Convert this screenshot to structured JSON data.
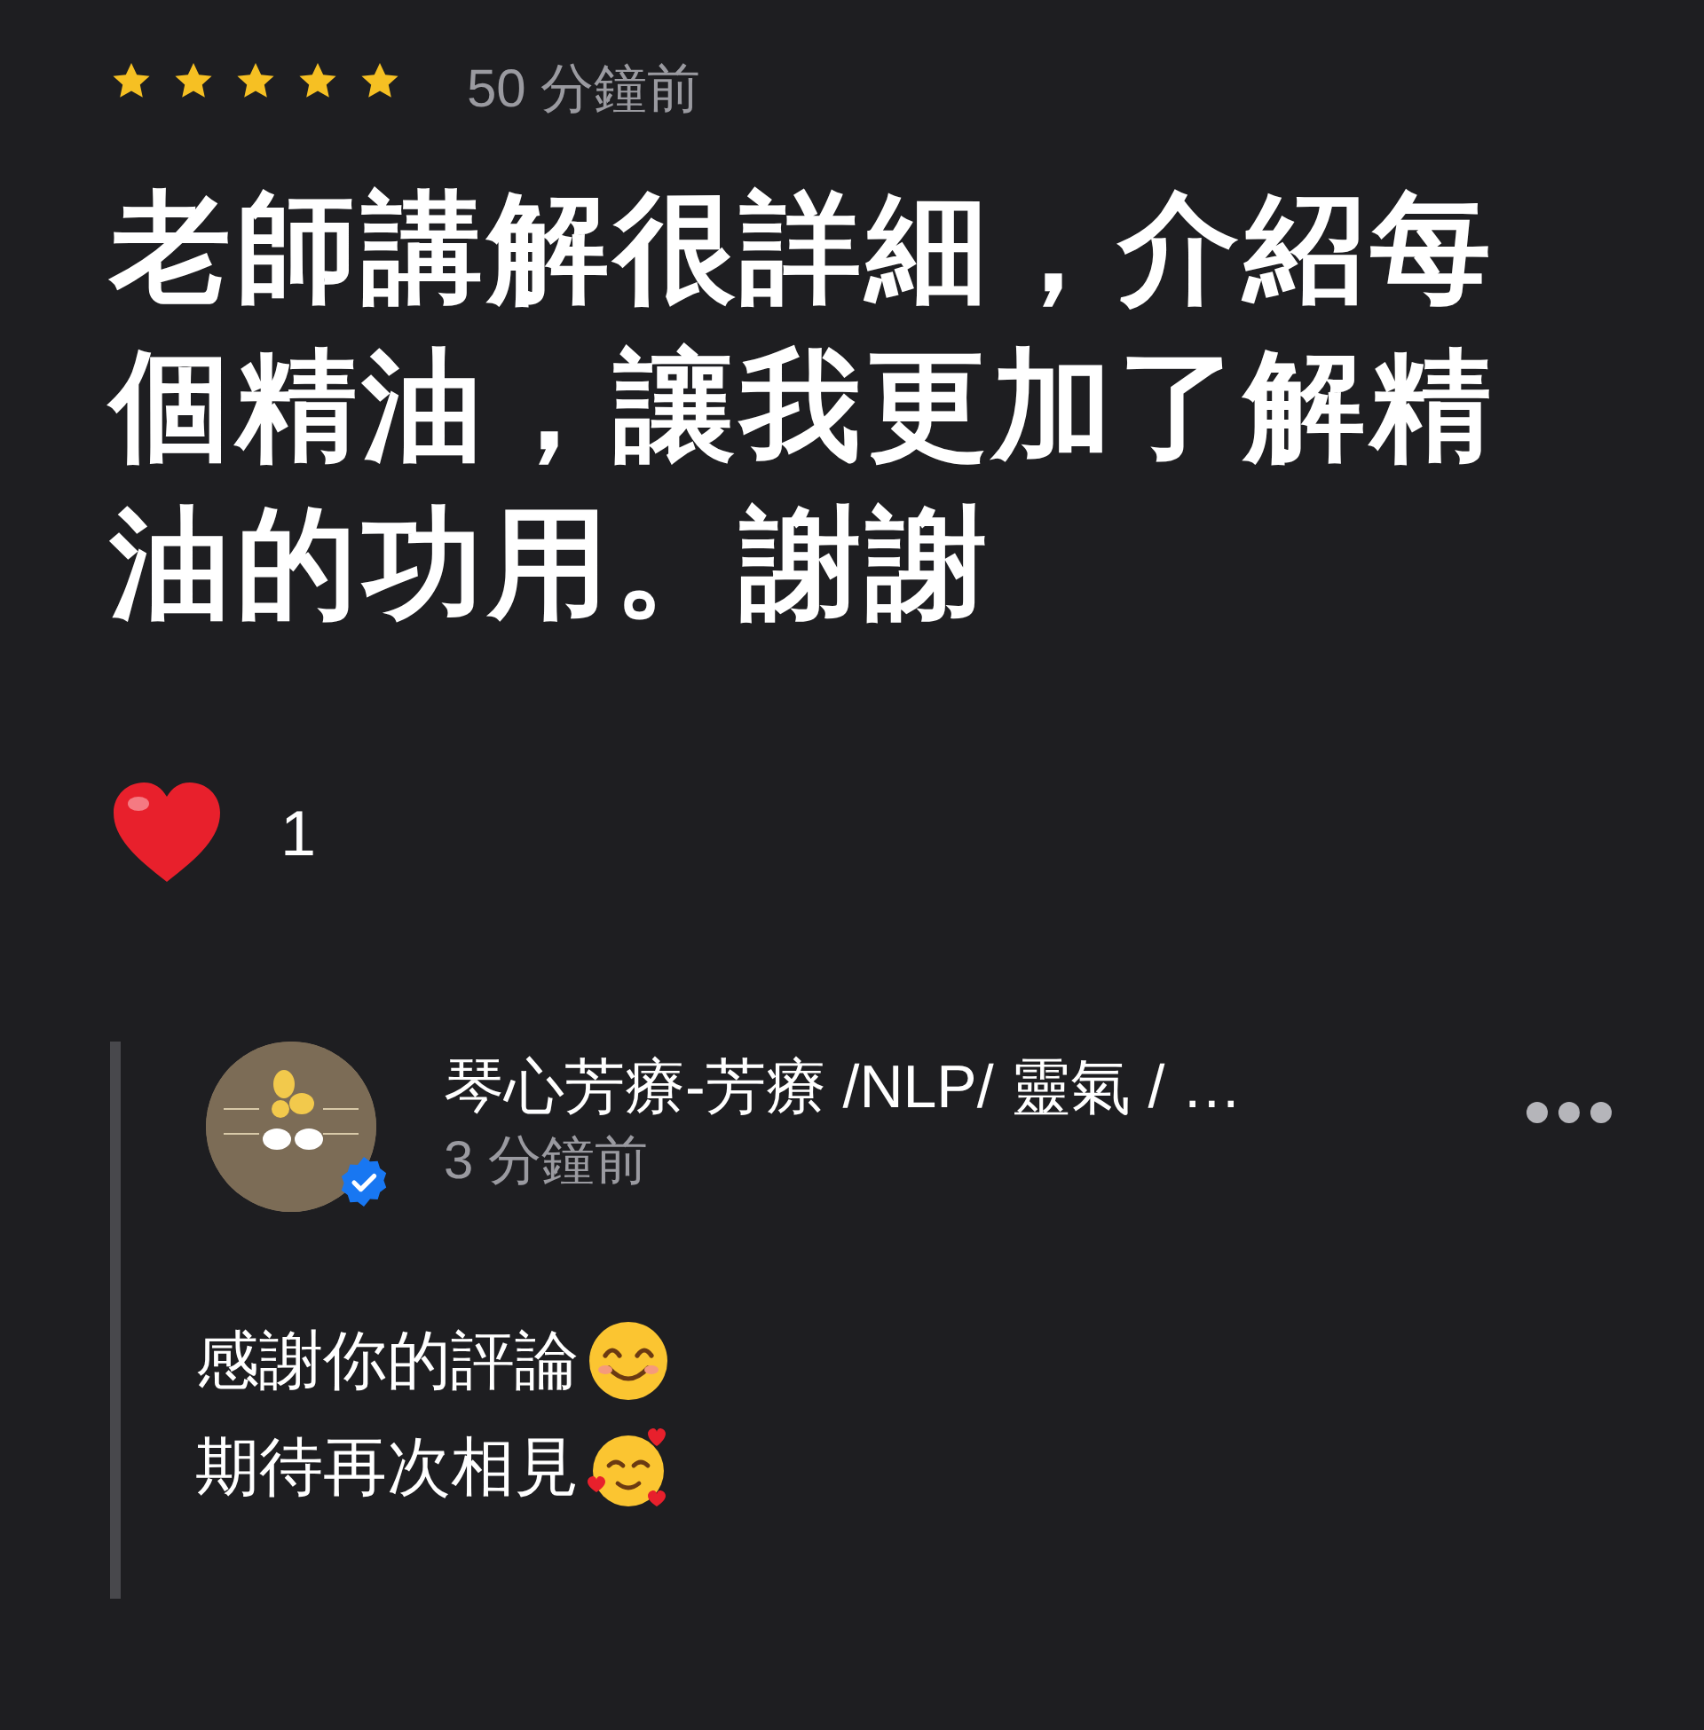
{
  "review": {
    "stars": 5,
    "time": "50 分鐘前",
    "text": "老師講解很詳細，介紹每個精油，讓我更加了解精油的功用。謝謝",
    "reaction": {
      "kind": "heart",
      "count": "1"
    }
  },
  "reply": {
    "author": "琴心芳療-芳療 /NLP/ 靈氣 / …",
    "verified": true,
    "time": "3 分鐘前",
    "lines": [
      {
        "text": "感謝你的評論",
        "kind": "smile"
      },
      {
        "text": "期待再次相見",
        "kind": "hearts"
      }
    ]
  }
}
